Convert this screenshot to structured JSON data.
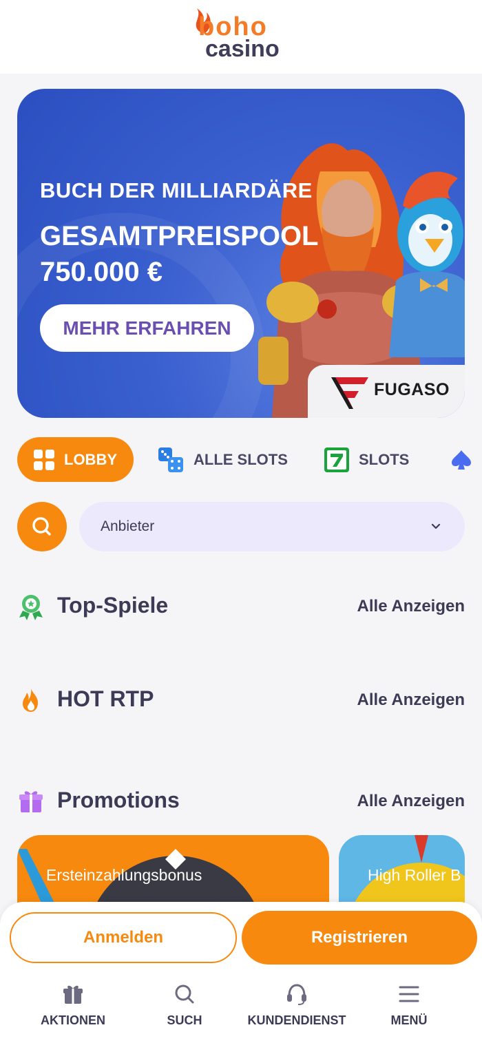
{
  "header": {
    "logo_top": "boho",
    "logo_bottom": "casino"
  },
  "banner": {
    "subtitle": "BUCH DER MILLIARDÄRE",
    "title": "GESAMTPREISPOOL 750.000 €",
    "cta_label": "MEHR ERFAHREN",
    "provider": "FUGASO"
  },
  "tabs": [
    {
      "label": "LOBBY",
      "icon": "grid-icon",
      "active": true
    },
    {
      "label": "ALLE SLOTS",
      "icon": "dice-icon",
      "active": false
    },
    {
      "label": "SLOTS",
      "icon": "seven-icon",
      "active": false
    },
    {
      "label": "",
      "icon": "spade-icon",
      "active": false
    }
  ],
  "filter": {
    "provider_select_value": "Anbieter"
  },
  "sections": [
    {
      "title": "Top-Spiele",
      "link": "Alle Anzeigen",
      "icon": "award-icon"
    },
    {
      "title": "HOT RTP",
      "link": "Alle Anzeigen",
      "icon": "flame-icon"
    },
    {
      "title": "Promotions",
      "link": "Alle Anzeigen",
      "icon": "gift-icon"
    }
  ],
  "promotions": [
    {
      "label": "Ersteinzahlungsbonus"
    },
    {
      "label": "High Roller B"
    }
  ],
  "auth": {
    "login_label": "Anmelden",
    "register_label": "Registrieren"
  },
  "bottom_nav": [
    {
      "label": "AKTIONEN",
      "icon": "gift-icon"
    },
    {
      "label": "SUCH",
      "icon": "search-icon"
    },
    {
      "label": "KUNDENDIENST",
      "icon": "headset-icon"
    },
    {
      "label": "MENÜ",
      "icon": "menu-icon"
    }
  ],
  "colors": {
    "accent": "#f7890f",
    "brand_orange": "#f47c26",
    "text_dark": "#3c3a55",
    "banner_blue": "#3a5fcf",
    "select_bg": "#ebe9fb"
  }
}
